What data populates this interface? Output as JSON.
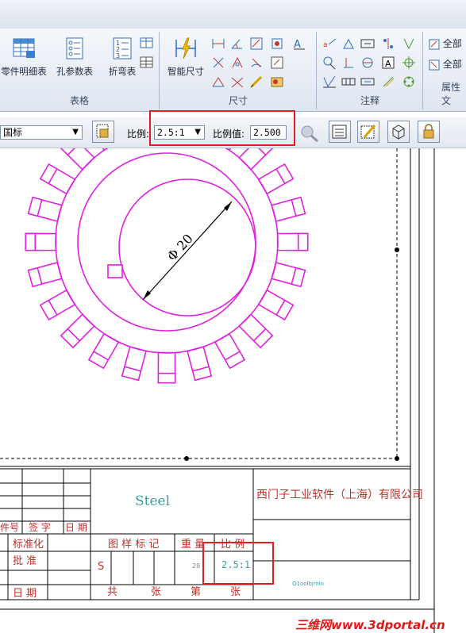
{
  "ribbon": {
    "groups": [
      {
        "label": "表格"
      },
      {
        "label": "尺寸"
      },
      {
        "label": "注释"
      },
      {
        "label": "属性文"
      }
    ],
    "table_buttons": [
      "零件明细表",
      "孔参数表",
      "折弯表"
    ],
    "dim_button": "智能尺寸",
    "attr_items": [
      "全部",
      "全部"
    ]
  },
  "toolbar": {
    "standard_value": "国标",
    "scale_label": "比例:",
    "scale_value": "2.5:1",
    "scale_value_label": "比例值:",
    "scale_value_input": "2.500"
  },
  "drawing": {
    "dimension_text": "Φ 20",
    "material": "Steel",
    "company": "西门子工业软件（上海）有限公司",
    "title_block": {
      "row_labels_left": [
        "件号",
        "签 字",
        "日 期"
      ],
      "standardization": "标准化",
      "approve": "批 准",
      "date": "日 期",
      "sample_marks": "图 样 标 记",
      "weight": "重 量",
      "scale": "比 例",
      "scale_value": "2.5:1",
      "s_mark": "S",
      "small_num": "28",
      "total": "共",
      "sheets": "张",
      "nth": "第",
      "sheets2": "张",
      "small_text": "Q1oolbjmin"
    }
  },
  "watermark": "三维网www.3dportal.cn"
}
